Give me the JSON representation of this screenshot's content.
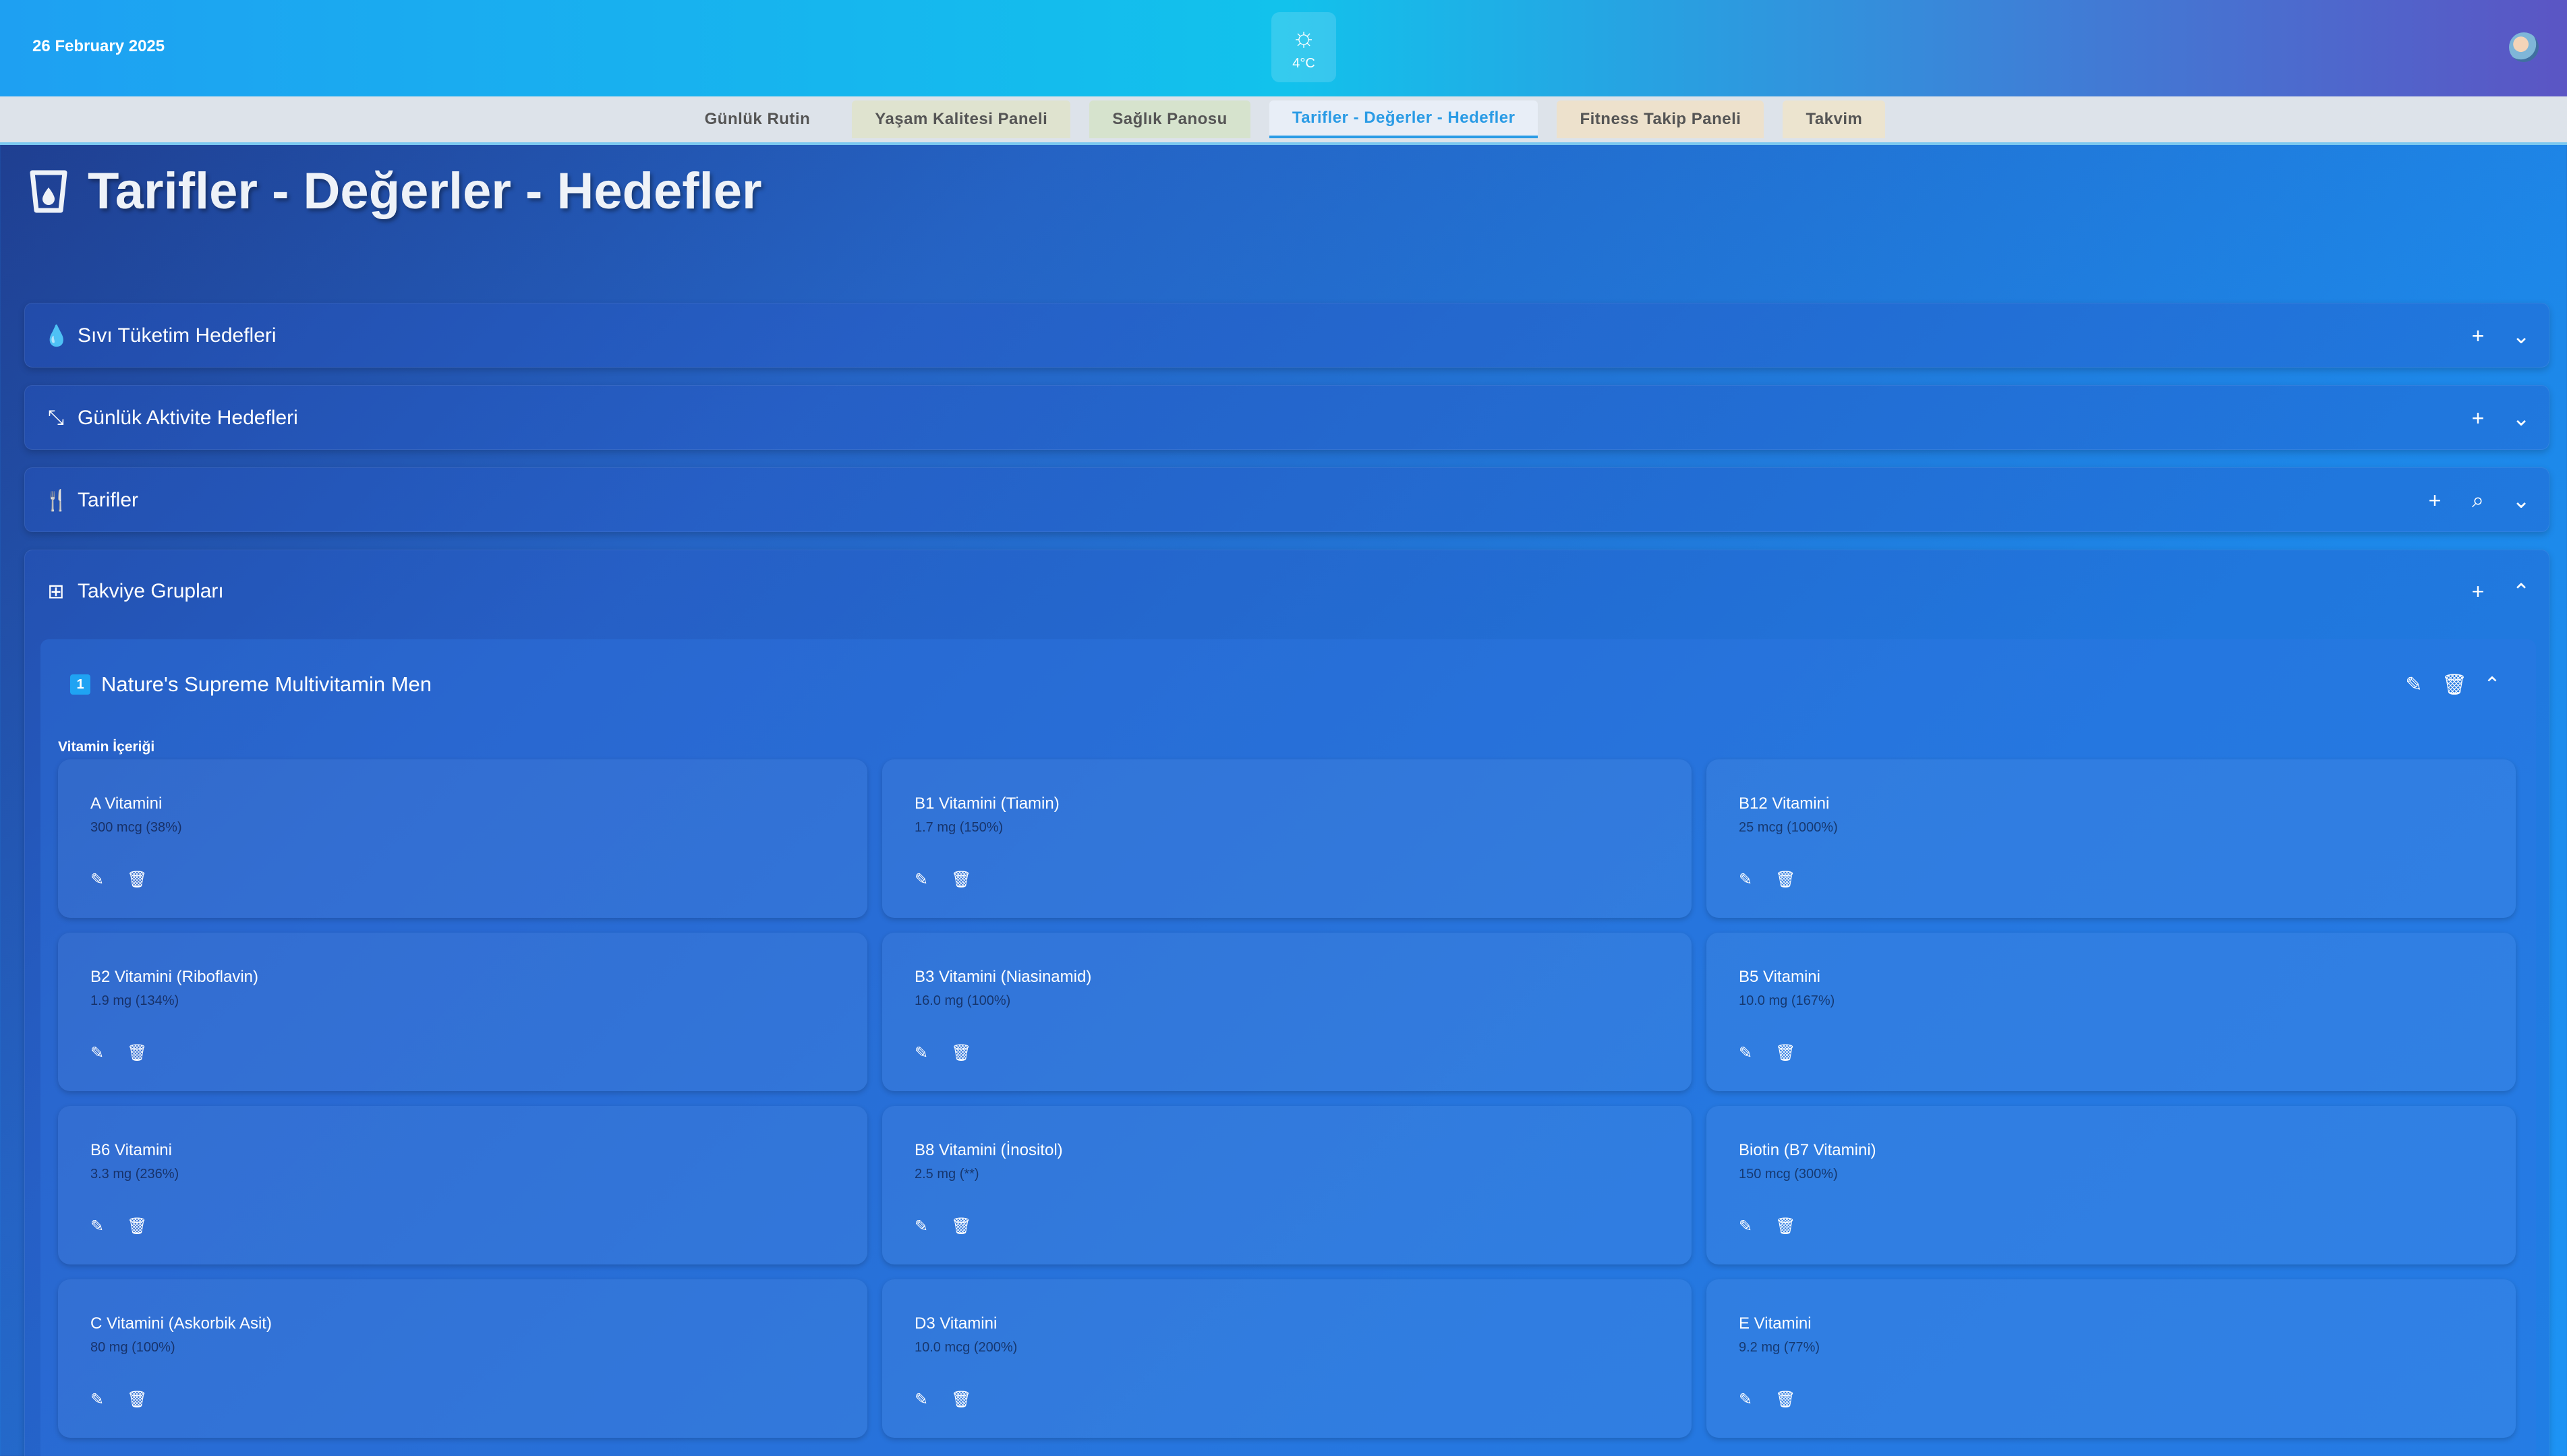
{
  "header": {
    "date": "26 February 2025",
    "weather_icon": "sun-icon",
    "temperature": "4°C",
    "weather_sun_glyph": "☼"
  },
  "tabs": [
    {
      "label": "Günlük Rutin"
    },
    {
      "label": "Yaşam Kalitesi Paneli"
    },
    {
      "label": "Sağlık Panosu"
    },
    {
      "label": "Tarifler - Değerler - Hedefler"
    },
    {
      "label": "Fitness Takip Paneli"
    },
    {
      "label": "Takvim"
    }
  ],
  "page": {
    "title": "Tarifler - Değerler - Hedefler"
  },
  "sections": [
    {
      "label": "Sıvı Tüketim Hedefleri",
      "icon": "water-drop-icon",
      "glyph": "💧"
    },
    {
      "label": "Günlük Aktivite Hedefleri",
      "icon": "expand-arrows-icon",
      "glyph": "⤡"
    },
    {
      "label": "Tarifler",
      "icon": "cutlery-icon",
      "glyph": "🍴"
    },
    {
      "label": "Takviye Grupları",
      "icon": "supplement-icon",
      "glyph": "⊞"
    }
  ],
  "glyphs": {
    "add": "+",
    "chevron_down": "⌄",
    "chevron_up": "⌃",
    "search": "⌕",
    "edit": "✎",
    "delete": "🗑"
  },
  "group": {
    "badge": "1",
    "title": "Nature's Supreme Multivitamin Men",
    "content_label": "Vitamin İçeriği",
    "vitamins": [
      {
        "name": "A Vitamini",
        "amount": "300 mcg (38%)"
      },
      {
        "name": "B1 Vitamini (Tiamin)",
        "amount": "1.7 mg (150%)"
      },
      {
        "name": "B12 Vitamini",
        "amount": "25 mcg (1000%)"
      },
      {
        "name": "B2 Vitamini (Riboflavin)",
        "amount": "1.9 mg (134%)"
      },
      {
        "name": "B3 Vitamini (Niasinamid)",
        "amount": "16.0 mg (100%)"
      },
      {
        "name": "B5 Vitamini",
        "amount": "10.0 mg (167%)"
      },
      {
        "name": "B6 Vitamini",
        "amount": "3.3 mg (236%)"
      },
      {
        "name": "B8 Vitamini (İnositol)",
        "amount": "2.5 mg (**)"
      },
      {
        "name": "Biotin (B7 Vitamini)",
        "amount": "150 mcg (300%)"
      },
      {
        "name": "C Vitamini (Askorbik Asit)",
        "amount": "80 mg (100%)"
      },
      {
        "name": "D3 Vitamini",
        "amount": "10.0 mcg (200%)"
      },
      {
        "name": "E Vitamini",
        "amount": "9.2 mg (77%)"
      }
    ]
  }
}
